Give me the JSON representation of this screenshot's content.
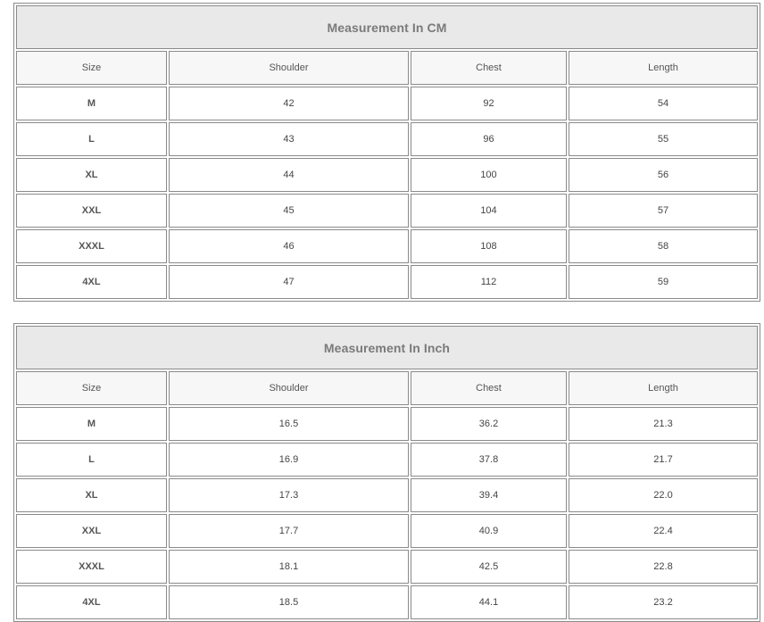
{
  "tables": [
    {
      "title": "Measurement In CM",
      "headers": [
        "Size",
        "Shoulder",
        "Chest",
        "Length"
      ],
      "rows": [
        [
          "M",
          "42",
          "92",
          "54"
        ],
        [
          "L",
          "43",
          "96",
          "55"
        ],
        [
          "XL",
          "44",
          "100",
          "56"
        ],
        [
          "XXL",
          "45",
          "104",
          "57"
        ],
        [
          "XXXL",
          "46",
          "108",
          "58"
        ],
        [
          "4XL",
          "47",
          "112",
          "59"
        ]
      ]
    },
    {
      "title": "Measurement In Inch",
      "headers": [
        "Size",
        "Shoulder",
        "Chest",
        "Length"
      ],
      "rows": [
        [
          "M",
          "16.5",
          "36.2",
          "21.3"
        ],
        [
          "L",
          "16.9",
          "37.8",
          "21.7"
        ],
        [
          "XL",
          "17.3",
          "39.4",
          "22.0"
        ],
        [
          "XXL",
          "17.7",
          "40.9",
          "22.4"
        ],
        [
          "XXXL",
          "18.1",
          "42.5",
          "22.8"
        ],
        [
          "4XL",
          "18.5",
          "44.1",
          "23.2"
        ]
      ]
    }
  ],
  "colors": {
    "title_background": "#e9e9e9",
    "title_text": "#7a7a7a",
    "header_background": "#f7f7f7",
    "border": "#8a8a8a"
  }
}
